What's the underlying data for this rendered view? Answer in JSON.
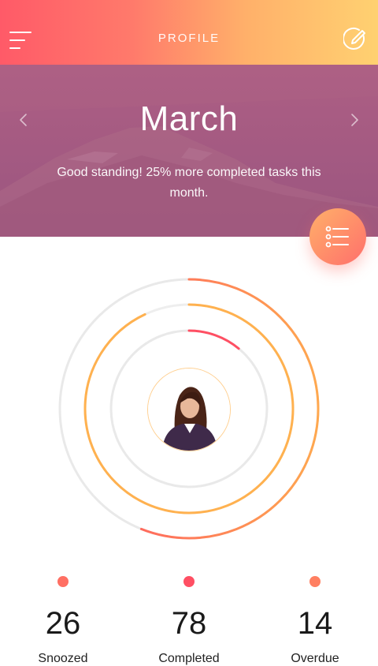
{
  "header": {
    "title": "PROFILE",
    "menu_icon": "menu-icon",
    "edit_icon": "edit-check-icon",
    "gradient": [
      "#ff5a68",
      "#ffd171"
    ]
  },
  "banner": {
    "month": "March",
    "message": "Good standing! 25% more completed tasks this month.",
    "prev_icon": "chevron-left-icon",
    "next_icon": "chevron-right-icon",
    "background": "#a45a82"
  },
  "fab": {
    "icon": "list-icon"
  },
  "progress": {
    "outer_ring_fraction": 0.56,
    "middle_ring_fraction": 0.93,
    "inner_ring_fraction": 0.11,
    "colors": {
      "track": "#e9e9e9",
      "red": "#ff4f63",
      "orange": "#ffb14f"
    }
  },
  "stats": [
    {
      "value": "26",
      "label": "Snoozed",
      "dot_color": "#ff6f63"
    },
    {
      "value": "78",
      "label": "Completed",
      "dot_color": "#ff4f63"
    },
    {
      "value": "14",
      "label": "Overdue",
      "dot_color": "#ff7f61"
    }
  ]
}
